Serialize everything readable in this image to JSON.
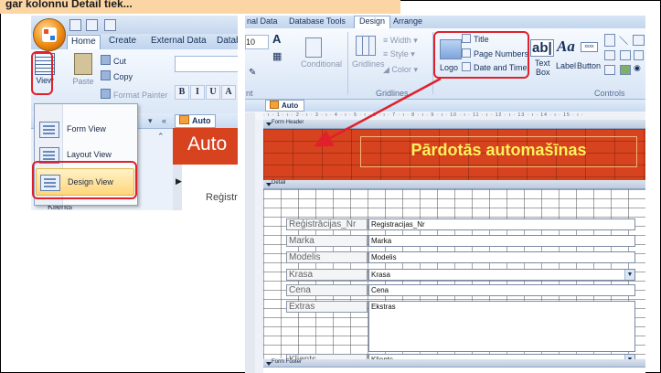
{
  "caption": "gar kolonnu Detail tiek...",
  "left": {
    "tabs": [
      "Home",
      "Create",
      "External Data",
      "Datab"
    ],
    "view_label": "View",
    "paste_label": "Paste",
    "cut_label": "Cut",
    "copy_label": "Copy",
    "format_painter_label": "Format Painter",
    "format_buttons": [
      "B",
      "I",
      "U",
      "A"
    ],
    "menu": [
      {
        "label": "Form View",
        "icon": "form-view-icon"
      },
      {
        "label": "Layout View",
        "icon": "layout-view-icon"
      },
      {
        "label": "Design View",
        "icon": "design-view-icon"
      }
    ],
    "nav_controls": [
      "▾",
      "«"
    ],
    "nav_collapse": "⌃",
    "doc_tab": "Auto",
    "form_title": "Auto",
    "form_body_text": "Reģistr",
    "nav_item": "Klients"
  },
  "right": {
    "tabs": [
      "nal Data",
      "Database Tools",
      "Design",
      "Arrange"
    ],
    "active_tab": "Design",
    "ribbon": {
      "font_size": "10",
      "conditional": "Conditional",
      "gridlines": "Gridlines",
      "width": "Width",
      "style": "Style",
      "color": "Color",
      "logo": "Logo",
      "title": "Title",
      "page_numbers": "Page Numbers",
      "date_time": "Date and Time",
      "text_box_1": "Text",
      "text_box_2": "Box",
      "label": "Label",
      "button": "Button",
      "aa": "Aa",
      "abl": "ab|",
      "xxxx": "xxxx"
    },
    "group_labels": [
      "nt",
      "Gridlines",
      "Controls"
    ],
    "doc_tab": "Auto",
    "ruler": "· ı · 1 · ı · 2 · ı · 3 · ı · 4 · ı · 5 · ı · 6 · ı · 7 · ı · 8 · ı · 9 · ı · 10 · ı · 11 · ı · 12 · ı · 13 · ı · 14 · ı · 15 · ı ·",
    "sections": {
      "header": "Form Header",
      "detail": "Detail",
      "footer": "Form Footer"
    },
    "form_title": "Pārdotās automašīnas",
    "fields": [
      {
        "label": "Reģistrācijas_Nr",
        "value": "Registracijas_Nr",
        "combo": false
      },
      {
        "label": "Marka",
        "value": "Marka",
        "combo": false
      },
      {
        "label": "Modelis",
        "value": "Modelis",
        "combo": false
      },
      {
        "label": "Krasa",
        "value": "Krasa",
        "combo": true
      },
      {
        "label": "Cena",
        "value": "Cena",
        "combo": false
      },
      {
        "label": "Extras",
        "value": "Ekstras",
        "combo": false
      },
      {
        "label": "Klients",
        "value": "Klients",
        "combo": true
      }
    ]
  },
  "colors": {
    "highlight_red": "#e0202a",
    "form_header": "#d7431e",
    "title_text": "#fff25a"
  }
}
